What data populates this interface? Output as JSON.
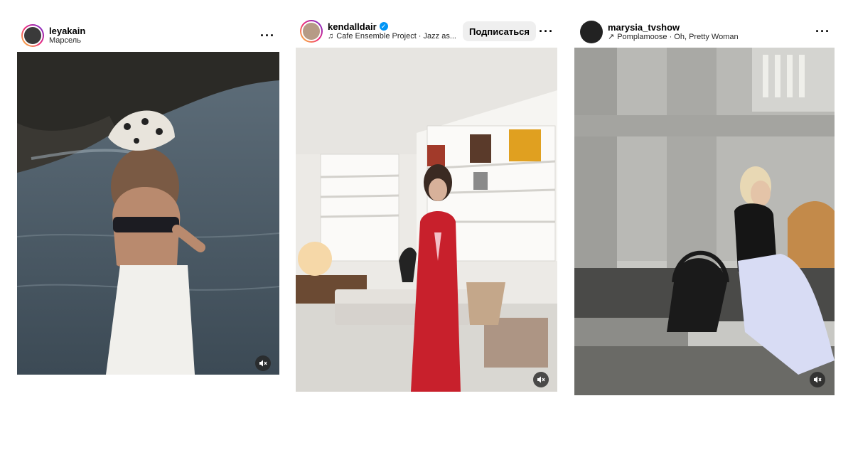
{
  "posts": [
    {
      "username": "leyakain",
      "subtitle": "Марсель",
      "subtitle_icon": "none",
      "verified": false,
      "more_icon": "more-horizontal-icon",
      "mute_icon": "speaker-muted-icon"
    },
    {
      "username": "kendalldair",
      "subtitle": "Cafe Ensemble Project · Jazz as...",
      "subtitle_icon": "music-note-icon",
      "verified": true,
      "follow_label": "Подписаться",
      "more_icon": "more-horizontal-icon",
      "mute_icon": "speaker-muted-icon"
    },
    {
      "username": "marysia_tvshow",
      "subtitle": "Pomplamoose · Oh, Pretty Woman",
      "subtitle_icon": "arrow-up-right-icon",
      "verified": false,
      "more_icon": "more-horizontal-icon",
      "mute_icon": "speaker-muted-icon"
    }
  ],
  "colors": {
    "verified": "#0095f6",
    "follow_bg": "#efefef",
    "story_ring": "#ee2a7b"
  }
}
